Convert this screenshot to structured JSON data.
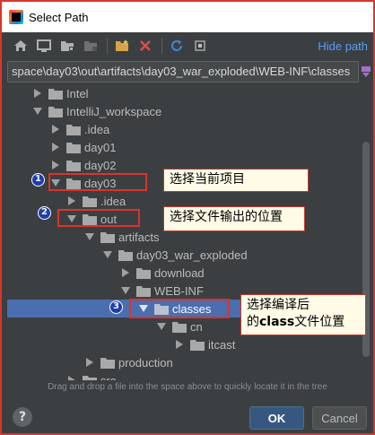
{
  "window": {
    "title": "Select Path"
  },
  "toolbar": {
    "buttons": [
      "home-icon",
      "desktop-icon",
      "project-folder-icon",
      "module-folder-icon",
      "new-folder-icon",
      "delete-icon",
      "refresh-icon",
      "show-hidden-icon"
    ],
    "hide_path_label": "Hide path"
  },
  "path": {
    "value": "space\\day03\\out\\artifacts\\day03_war_exploded\\WEB-INF\\classes"
  },
  "tree": {
    "items": [
      {
        "label": "Intel"
      },
      {
        "label": "IntelliJ_workspace"
      },
      {
        "label": ".idea"
      },
      {
        "label": "day01"
      },
      {
        "label": "day02"
      },
      {
        "label": "day03"
      },
      {
        "label": ".idea"
      },
      {
        "label": "out"
      },
      {
        "label": "artifacts"
      },
      {
        "label": "day03_war_exploded"
      },
      {
        "label": "download"
      },
      {
        "label": "WEB-INF"
      },
      {
        "label": "classes"
      },
      {
        "label": "cn"
      },
      {
        "label": "itcast"
      },
      {
        "label": "production"
      },
      {
        "label": "src"
      }
    ]
  },
  "annotations": {
    "callout1": "选择当前项目",
    "callout2": "选择文件输出的位置",
    "callout3_line1": "选择编译后",
    "callout3_line2_prefix": "的",
    "callout3_line2_bold": "class",
    "callout3_line2_suffix": "文件位置",
    "badge1": "1",
    "badge2": "2",
    "badge3": "3"
  },
  "footer": {
    "hint": "Drag and drop a file into the space above to quickly locate it in the tree",
    "help_label": "?",
    "ok_label": "OK",
    "cancel_label": "Cancel"
  },
  "colors": {
    "background": "#3c3f41",
    "selection": "#4b6eaf",
    "link": "#589df6",
    "highlight_border": "#d9342b",
    "callout_bg": "#fffbe6"
  }
}
